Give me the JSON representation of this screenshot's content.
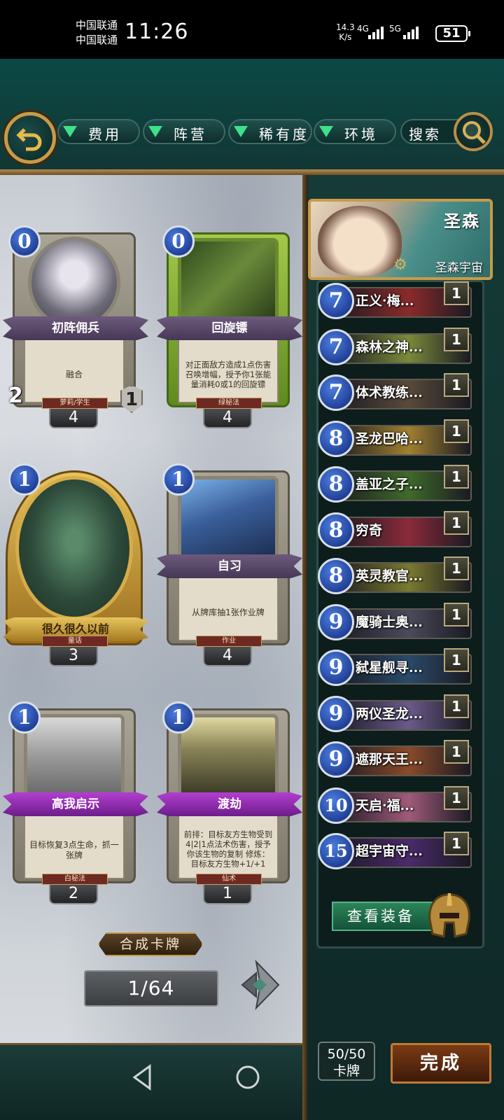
{
  "status_bar": {
    "carrier_1": "中国联通",
    "carrier_2": "中国联通",
    "time": "11:26",
    "net_speed": "14.3",
    "net_unit": "K/s",
    "signal_1": "4G",
    "signal_2": "5G",
    "battery": "51"
  },
  "filters": [
    {
      "label": "费用"
    },
    {
      "label": "阵营"
    },
    {
      "label": "稀有度"
    },
    {
      "label": "环境"
    }
  ],
  "search": {
    "label": "搜索"
  },
  "cards": [
    {
      "name": "初阵佣兵",
      "cost": "0",
      "text": "融合",
      "tribe": "萝莉/学生",
      "count": "4",
      "attack": "2",
      "health": "1",
      "art": "#6d6b78"
    },
    {
      "name": "回旋镖",
      "cost": "0",
      "text": "对正面敌方造成1点伤害 召唤增幅，授予你1张能量消耗0或1的回旋镖",
      "tribe": "绿秘法",
      "count": "4",
      "art": "#4e6b2a"
    },
    {
      "name": "很久很久以前",
      "cost": "1",
      "text": "",
      "tribe": "童话",
      "count": "3",
      "art": "#2d4a3a"
    },
    {
      "name": "自习",
      "cost": "1",
      "text": "从牌库抽1张作业牌",
      "tribe": "作业",
      "count": "4",
      "art": "#3a5f9a"
    },
    {
      "name": "高我启示",
      "cost": "1",
      "text": "目标恢复3点生命，抓一张牌",
      "tribe": "白秘法",
      "count": "2",
      "art": "#9a9a9a"
    },
    {
      "name": "渡劫",
      "cost": "1",
      "text": "前排：目标友方生物受到4|2|1点法术伤害，授予你该生物的复制 修炼：目标友方生物+1/+1",
      "tribe": "仙术",
      "count": "1",
      "art": "#5b5a3c"
    }
  ],
  "synthesize_label": "合成卡牌",
  "pagination": {
    "current": "1/64"
  },
  "hero": {
    "name": "圣森",
    "faction": "圣森宇宙"
  },
  "deck": [
    {
      "cost": "7",
      "name": "正义·梅...",
      "qty": "1",
      "color": "#8a2a2a"
    },
    {
      "cost": "7",
      "name": "森林之神...",
      "qty": "1",
      "color": "#7a8a3a"
    },
    {
      "cost": "7",
      "name": "体术教练...",
      "qty": "1",
      "color": "#5a4a3a"
    },
    {
      "cost": "8",
      "name": "圣龙巴哈...",
      "qty": "1",
      "color": "#a08030"
    },
    {
      "cost": "8",
      "name": "盖亚之子...",
      "qty": "1",
      "color": "#3f6a2a"
    },
    {
      "cost": "8",
      "name": "穷奇",
      "qty": "1",
      "color": "#8a2a3a"
    },
    {
      "cost": "8",
      "name": "英灵教官...",
      "qty": "1",
      "color": "#7a7a30"
    },
    {
      "cost": "9",
      "name": "魔骑士奥...",
      "qty": "1",
      "color": "#4a4a5a"
    },
    {
      "cost": "9",
      "name": "弑星舰寻...",
      "qty": "1",
      "color": "#2a4a6a"
    },
    {
      "cost": "9",
      "name": "两仪圣龙...",
      "qty": "1",
      "color": "#6a5a8a"
    },
    {
      "cost": "9",
      "name": "遮那天王...",
      "qty": "1",
      "color": "#8a4a2a"
    },
    {
      "cost": "10",
      "name": "天启·福...",
      "qty": "1",
      "color": "#a05a7a"
    },
    {
      "cost": "15",
      "name": "超宇宙守...",
      "qty": "1",
      "color": "#4a2a6a"
    }
  ],
  "equip_label": "查看装备",
  "deck_count": {
    "value": "50/50",
    "unit": "卡牌"
  },
  "done_label": "完成"
}
